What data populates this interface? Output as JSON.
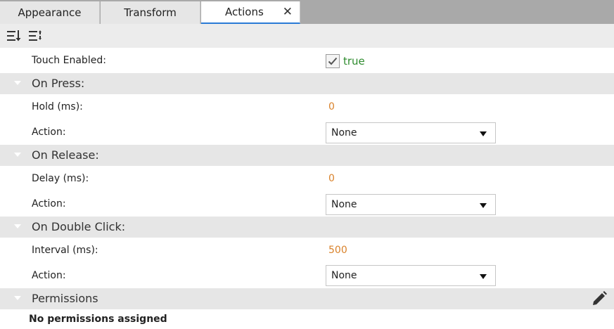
{
  "tabs": [
    {
      "label": "Appearance"
    },
    {
      "label": "Transform"
    },
    {
      "label": "Actions",
      "close": "✕"
    }
  ],
  "toolbar": {
    "sort_icon": "sort-list-icon",
    "categorize_icon": "categorize-list-icon"
  },
  "touch": {
    "label": "Touch Enabled:",
    "checked": true,
    "value": "true"
  },
  "on_press": {
    "title": "On Press:",
    "hold_label": "Hold (ms):",
    "hold_value": "0",
    "action_label": "Action:",
    "action_value": "None"
  },
  "on_release": {
    "title": "On Release:",
    "delay_label": "Delay (ms):",
    "delay_value": "0",
    "action_label": "Action:",
    "action_value": "None"
  },
  "on_double_click": {
    "title": "On Double Click:",
    "interval_label": "Interval (ms):",
    "interval_value": "500",
    "action_label": "Action:",
    "action_value": "None"
  },
  "permissions": {
    "title": "Permissions",
    "empty_text": "No permissions assigned",
    "edit_icon": "pencil-icon"
  },
  "colors": {
    "active_tab_accent": "#2a7ad6",
    "number_value": "#d9822b",
    "boolean_value": "#2e8b2e",
    "section_bg": "#e6e6e6"
  }
}
